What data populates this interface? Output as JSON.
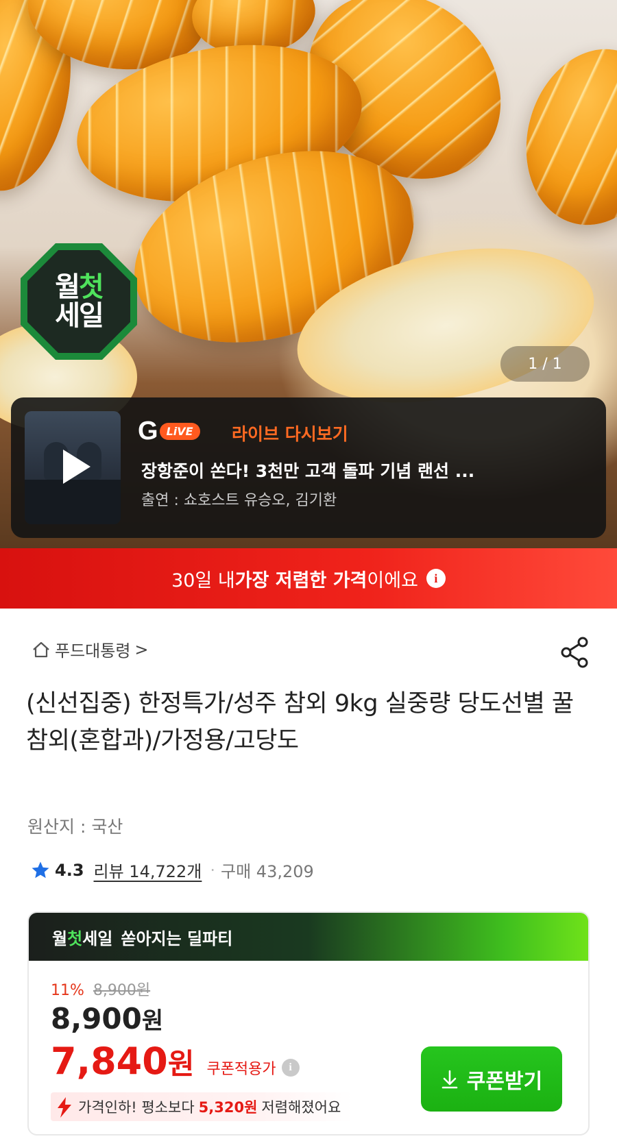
{
  "hero": {
    "badge_line1_a": "월",
    "badge_line1_b": "첫",
    "badge_line2": "세일",
    "image_counter": "1 / 1"
  },
  "live_banner": {
    "logo_g": "G",
    "logo_live": "LiVE",
    "tag": "라이브 다시보기",
    "title": "장항준이 쏜다! 3천만 고객 돌파 기념 랜선 ...",
    "cast": "출연 : 쇼호스트 유승오, 김기환"
  },
  "price_banner": {
    "prefix": "30일 내 ",
    "highlight": "가장 저렴한 가격",
    "suffix": "이에요"
  },
  "product": {
    "breadcrumb": "푸드대통령",
    "breadcrumb_chevron": ">",
    "title": "(신선집중) 한정특가/성주 참외 9kg 실중량 당도선별 꿀참외(혼합과)/가정용/고당도",
    "origin": "원산지 : 국산",
    "rating": "4.3",
    "reviews": "리뷰 14,722개",
    "separator": "·",
    "purchases": "구매 43,209"
  },
  "deal": {
    "head_a": "월",
    "head_b": "첫",
    "head_c": "세일",
    "head_d": "쏟아지는 딜파티",
    "discount_pct": "11%",
    "original_price": "8,900원",
    "price_value": "8,900",
    "price_unit": "원",
    "coupon_price_value": "7,840",
    "coupon_price_unit": "원",
    "coupon_applied": "쿠폰적용가",
    "price_drop_prefix": "가격인하! 평소보다",
    "price_drop_amount": "5,320원",
    "price_drop_suffix": "저렴해졌어요",
    "coupon_button": "쿠폰받기"
  },
  "icons": [
    "home-icon",
    "share-icon",
    "star-icon",
    "info-icon",
    "question-icon",
    "play-icon",
    "download-icon",
    "bolt-down-icon"
  ],
  "colors": {
    "accent_red": "#e51a14",
    "deal_green": "#1bb112",
    "live_orange": "#ff6a22",
    "star_blue": "#1f6fe5"
  }
}
